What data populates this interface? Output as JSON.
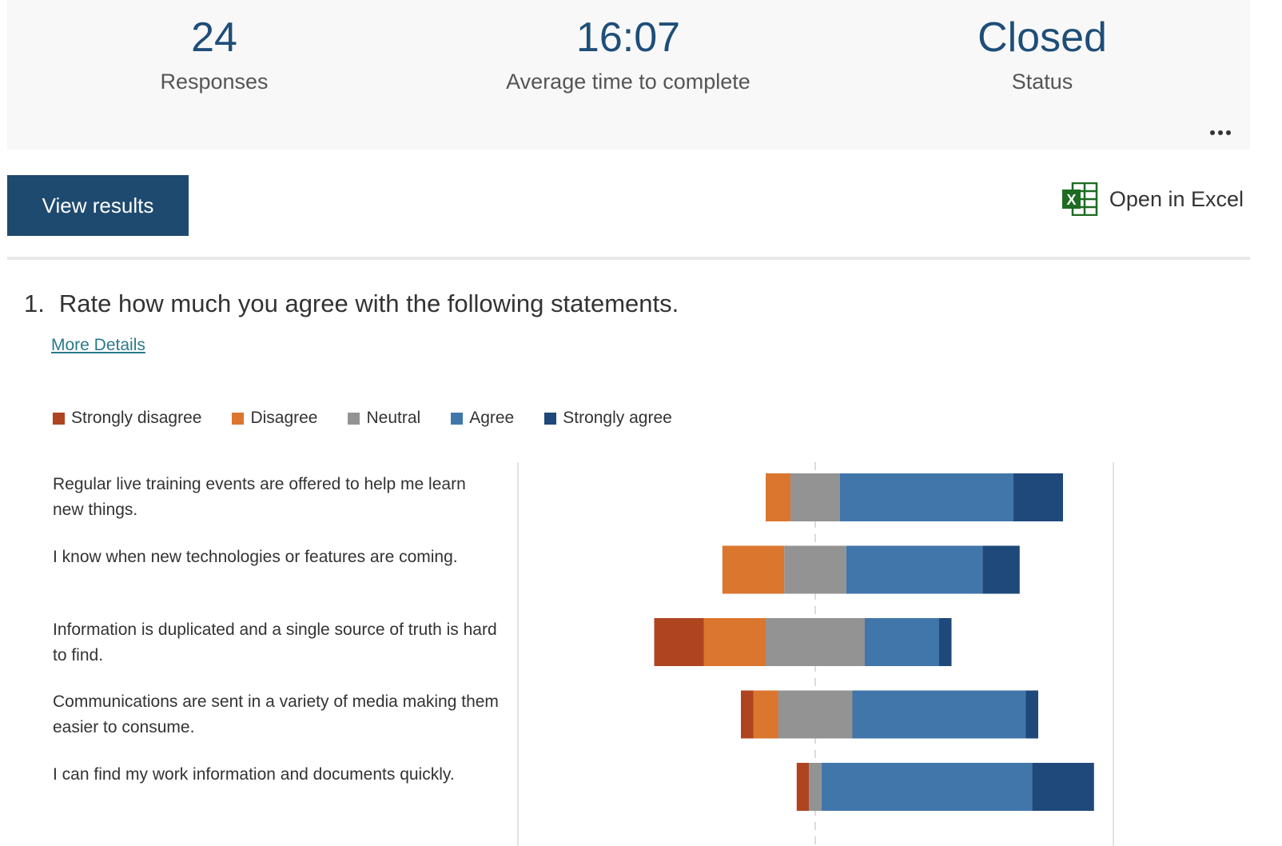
{
  "summary": {
    "responses": {
      "value": "24",
      "label": "Responses"
    },
    "avg_time": {
      "value": "16:07",
      "label": "Average time to complete"
    },
    "status": {
      "value": "Closed",
      "label": "Status"
    },
    "more_icon": "ellipsis-icon"
  },
  "actions": {
    "view_results_label": "View results",
    "open_excel_label": "Open in Excel",
    "excel_icon": "excel-icon"
  },
  "question": {
    "number": "1.",
    "title": "Rate how much you agree with the following statements.",
    "more_details_label": "More Details"
  },
  "colors": {
    "strongly_disagree": "#ae4520",
    "disagree": "#db762f",
    "neutral": "#939393",
    "agree": "#4176aa",
    "strongly_agree": "#1e497a",
    "accent": "#1f4a6f"
  },
  "chart_data": {
    "type": "bar",
    "subtype": "diverging-stacked-horizontal",
    "title": "",
    "xlabel": "",
    "ylabel": "",
    "legend_position": "top-left",
    "grid": false,
    "total_responses": 24,
    "categories": [
      "Regular live training events are offered to help me learn new things.",
      "I know when new technologies or features are coming.",
      "Information is duplicated and a single source of truth is hard to find.",
      "Communications are sent in a variety of media making them easier to consume.",
      "I can find my work information and documents quickly."
    ],
    "series": [
      {
        "name": "Strongly disagree",
        "key": "strongly_disagree",
        "values": [
          0,
          0,
          4,
          1,
          1
        ]
      },
      {
        "name": "Disagree",
        "key": "disagree",
        "values": [
          2,
          5,
          5,
          2,
          0
        ]
      },
      {
        "name": "Neutral",
        "key": "neutral",
        "values": [
          4,
          5,
          8,
          6,
          1
        ]
      },
      {
        "name": "Agree",
        "key": "agree",
        "values": [
          14,
          11,
          6,
          14,
          17
        ]
      },
      {
        "name": "Strongly agree",
        "key": "strongly_agree",
        "values": [
          4,
          3,
          1,
          1,
          5
        ]
      }
    ]
  }
}
